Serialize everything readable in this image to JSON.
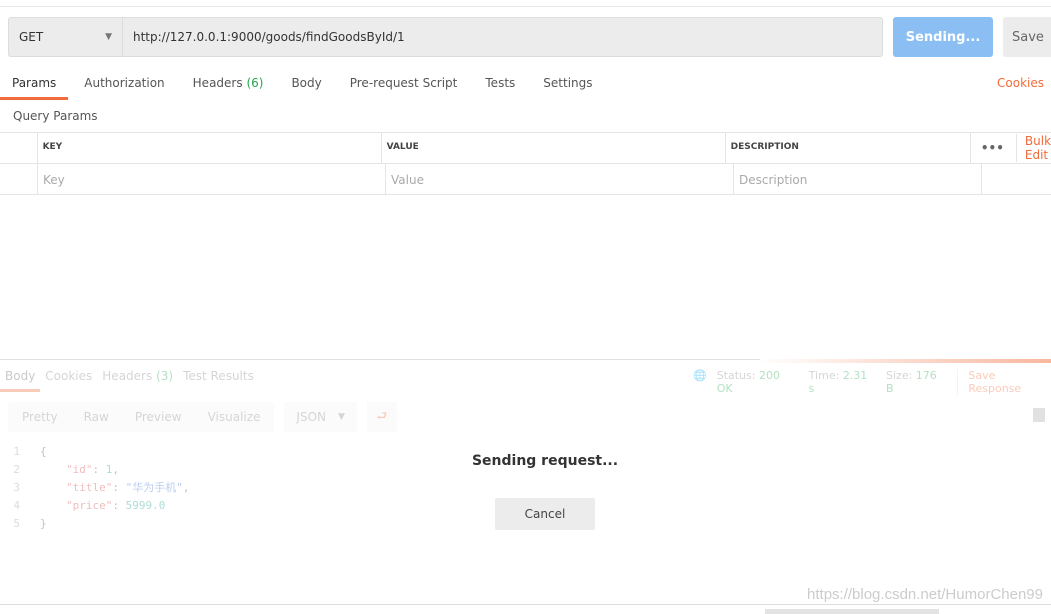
{
  "request": {
    "method": "GET",
    "url": "http://127.0.0.1:9000/goods/findGoodsById/1",
    "send_label": "Sending...",
    "save_label": "Save"
  },
  "tabs": [
    {
      "label": "Params"
    },
    {
      "label": "Authorization"
    },
    {
      "label": "Headers",
      "count": "(6)"
    },
    {
      "label": "Body"
    },
    {
      "label": "Pre-request Script"
    },
    {
      "label": "Tests"
    },
    {
      "label": "Settings"
    }
  ],
  "cookies_label": "Cookies",
  "query_params": {
    "title": "Query Params",
    "headers": [
      "KEY",
      "VALUE",
      "DESCRIPTION"
    ],
    "placeholders": [
      "Key",
      "Value",
      "Description"
    ],
    "bulk_label": "Bulk Edit"
  },
  "response": {
    "tabs": [
      {
        "label": "Body"
      },
      {
        "label": "Cookies"
      },
      {
        "label": "Headers",
        "count": "(3)"
      },
      {
        "label": "Test Results"
      }
    ],
    "status_label": "Status:",
    "status": "200 OK",
    "time_label": "Time:",
    "time": "2.31 s",
    "size_label": "Size:",
    "size": "176 B",
    "save_response": "Save Response",
    "views": [
      "Pretty",
      "Raw",
      "Preview",
      "Visualize"
    ],
    "format": "JSON",
    "lines": [
      {
        "n": "1",
        "text": "{"
      },
      {
        "n": "2",
        "key": "\"id\"",
        "value": "1",
        "type": "num",
        "tail": ","
      },
      {
        "n": "3",
        "key": "\"title\"",
        "value": "\"华为手机\"",
        "type": "str",
        "tail": ","
      },
      {
        "n": "4",
        "key": "\"price\"",
        "value": "5999.0",
        "type": "num",
        "tail": ""
      },
      {
        "n": "5",
        "text": "}"
      }
    ]
  },
  "overlay": {
    "message": "Sending request...",
    "cancel_label": "Cancel"
  },
  "watermark": "https://blog.csdn.net/HumorChen99",
  "colors": {
    "accent": "#f26b3a",
    "send_button": "#8bbff4",
    "success": "#26a650"
  }
}
